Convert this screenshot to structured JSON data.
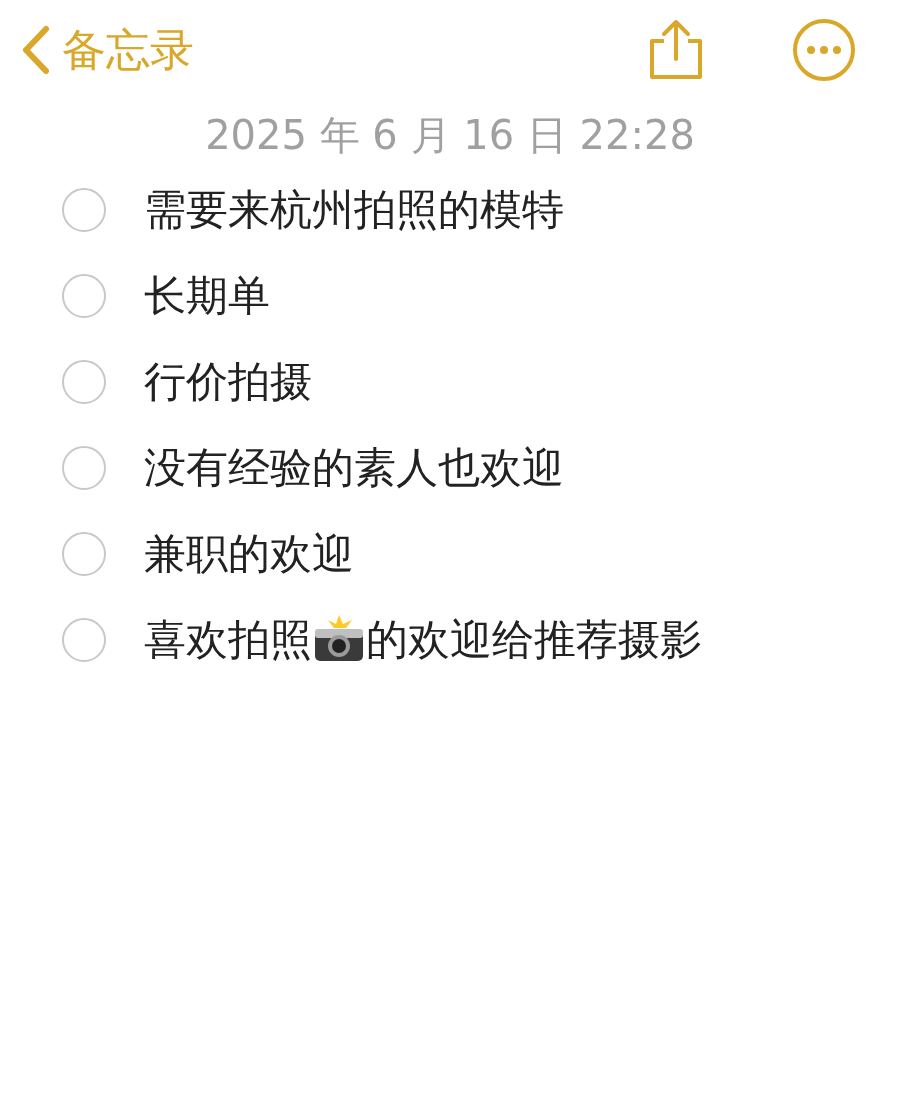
{
  "nav": {
    "back_label": "备忘录"
  },
  "date": "2025 年 6 月 16 日 22:28",
  "checklist": [
    {
      "checked": false,
      "parts": [
        {
          "kind": "text",
          "text": "需要来杭州拍照的模特"
        }
      ]
    },
    {
      "checked": false,
      "parts": [
        {
          "kind": "text",
          "text": "长期单"
        }
      ]
    },
    {
      "checked": false,
      "parts": [
        {
          "kind": "text",
          "text": "行价拍摄"
        }
      ]
    },
    {
      "checked": false,
      "parts": [
        {
          "kind": "text",
          "text": "没有经验的素人也欢迎"
        }
      ]
    },
    {
      "checked": false,
      "parts": [
        {
          "kind": "text",
          "text": "兼职的欢迎"
        }
      ]
    },
    {
      "checked": false,
      "parts": [
        {
          "kind": "text",
          "text": "喜欢拍照"
        },
        {
          "kind": "emoji"
        },
        {
          "kind": "text",
          "text": "的欢迎给推荐摄影"
        }
      ]
    }
  ]
}
